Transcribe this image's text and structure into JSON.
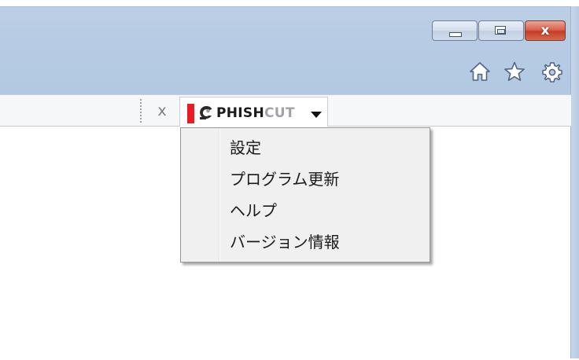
{
  "window": {
    "caption_buttons": {
      "minimize_icon": "minimize-icon",
      "maximize_icon": "maximize-icon",
      "close_glyph": "x",
      "close_color": "#c8452c"
    },
    "toolbar_icons": [
      "home-icon",
      "star-icon",
      "gear-icon"
    ]
  },
  "command_bar": {
    "close_glyph": "x",
    "phishcut": {
      "logo_phish": "PHISH",
      "logo_cut": "CUT",
      "logo_bar_color": "#ea1b22",
      "dropdown_icon": "caret-down-icon"
    }
  },
  "menu": {
    "items": [
      {
        "label": "設定"
      },
      {
        "label": "プログラム更新"
      },
      {
        "label": "ヘルプ"
      },
      {
        "label": "バージョン情報"
      }
    ]
  }
}
